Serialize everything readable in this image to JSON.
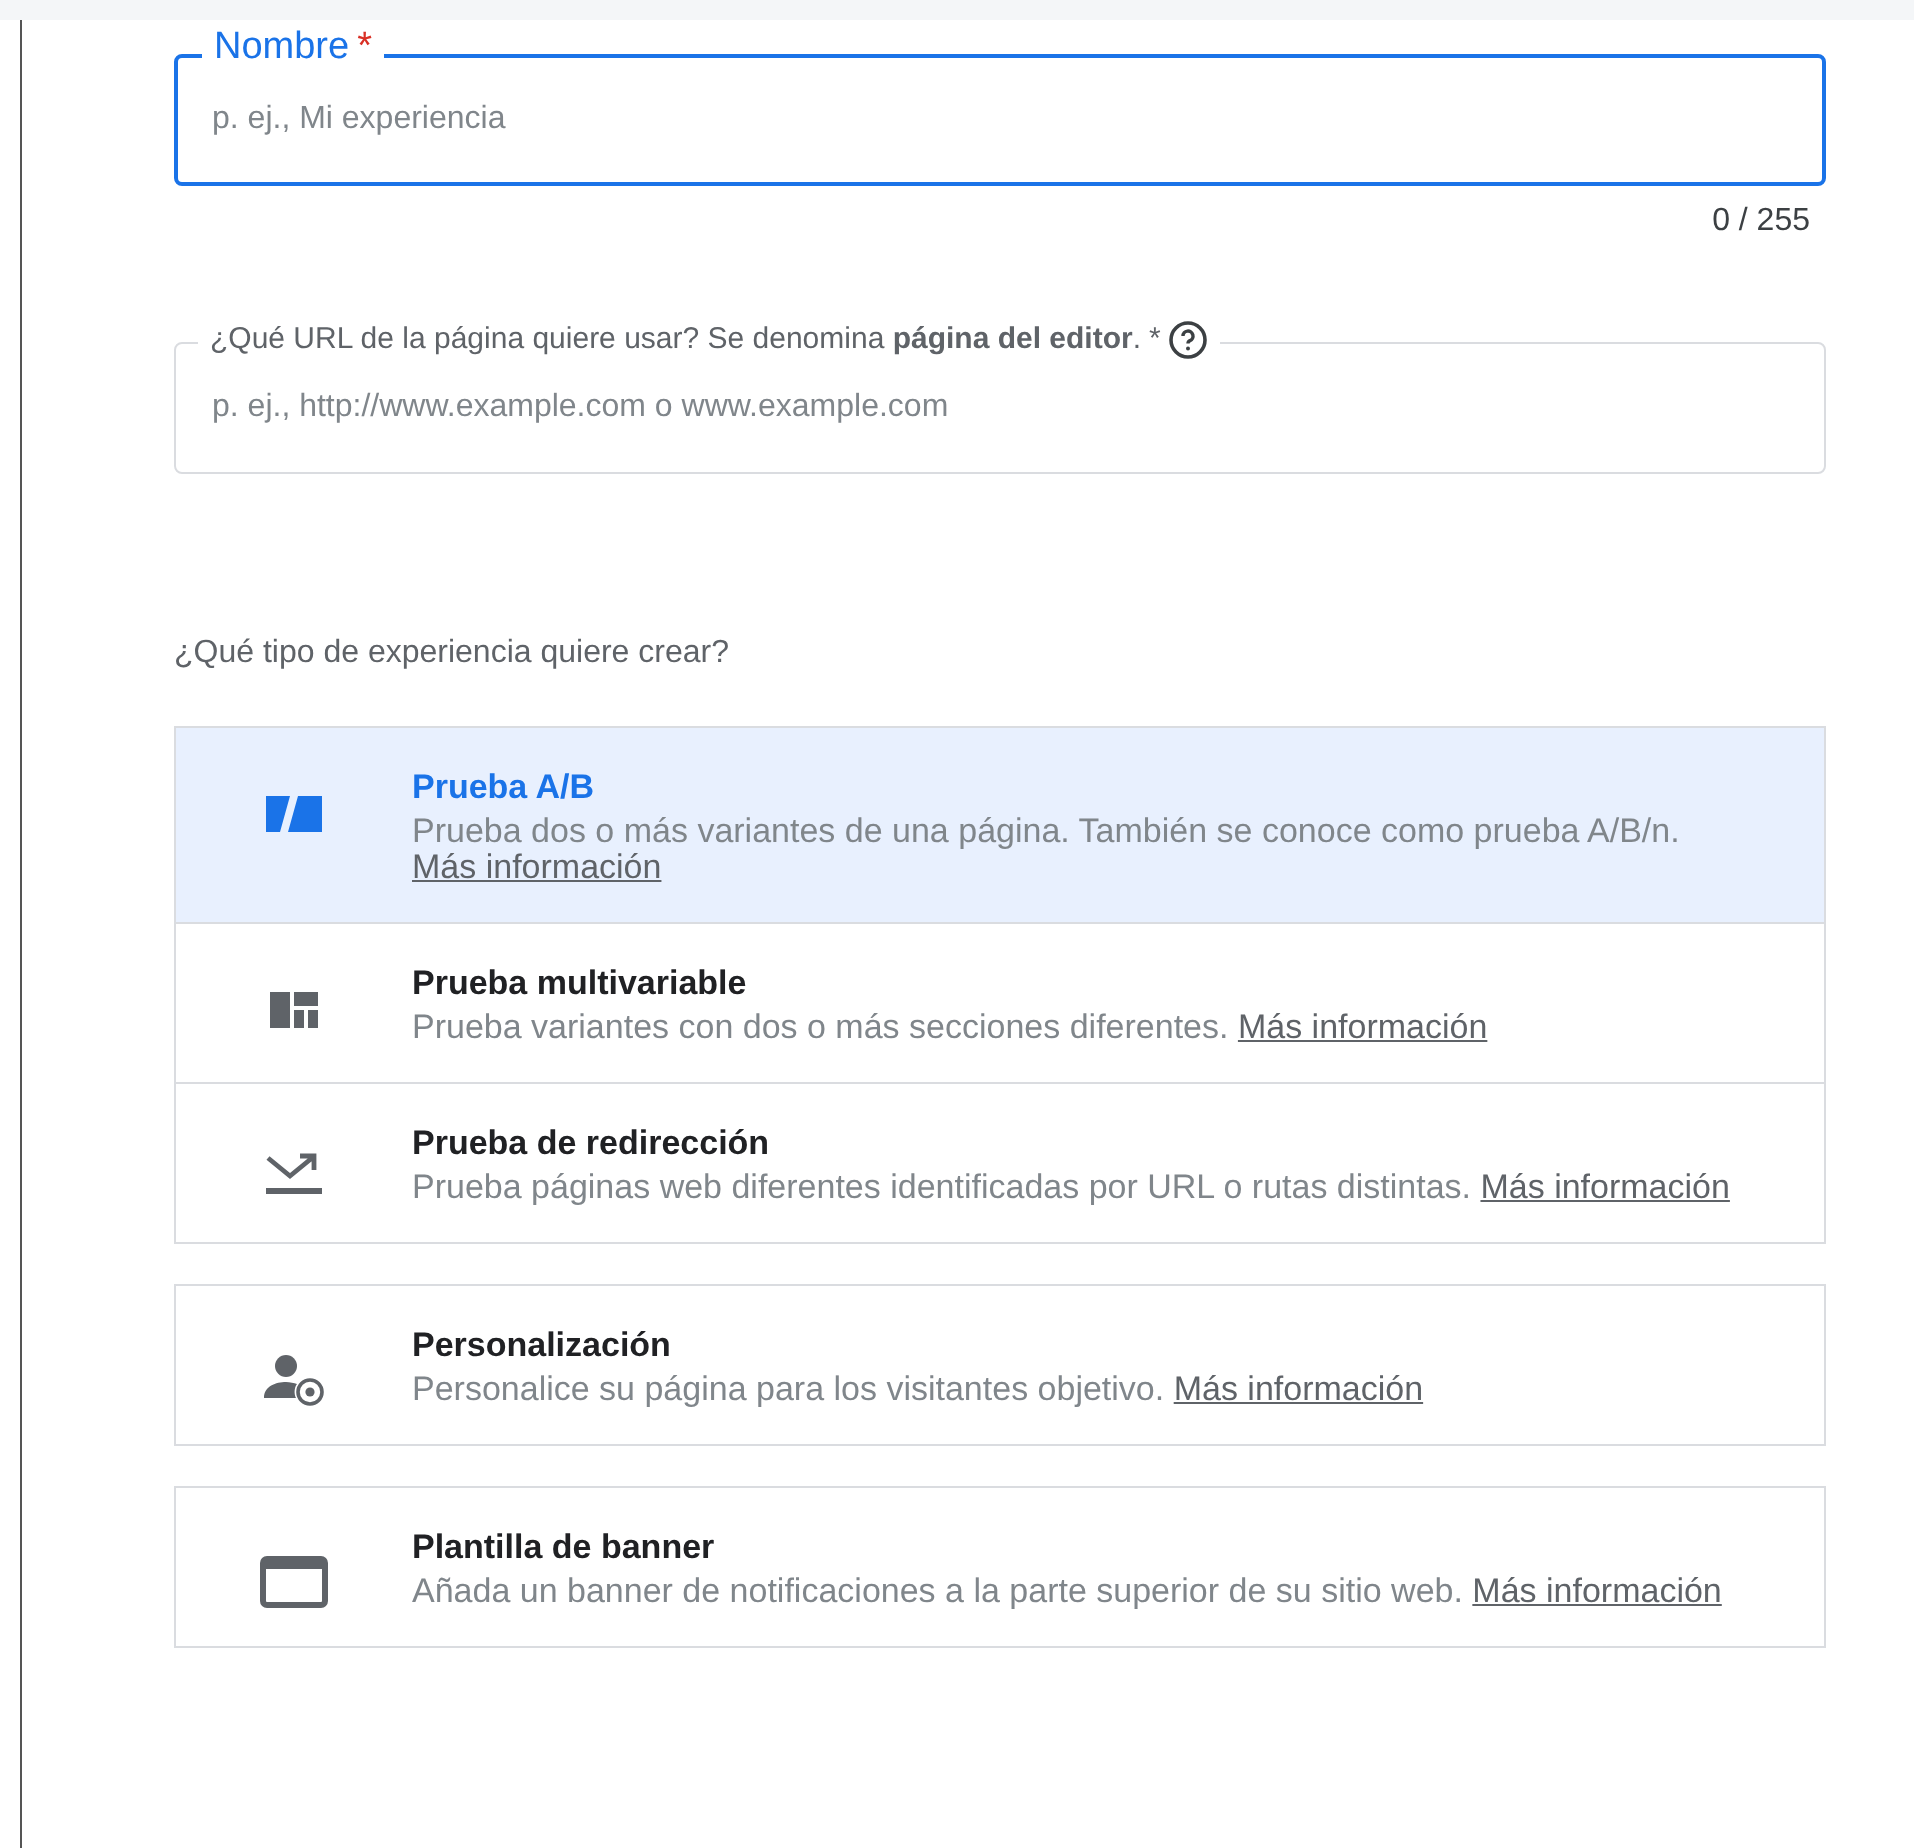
{
  "name_field": {
    "label": "Nombre",
    "required_mark": "*",
    "placeholder": "p. ej., Mi experiencia",
    "focused": true,
    "counter": "0 / 255"
  },
  "url_field": {
    "label": "¿Qué URL de la página quiere usar? Se denomina **página del editor**.",
    "required_mark": "*",
    "placeholder": "p. ej., http://www.example.com o www.example.com",
    "focused": false
  },
  "question": "¿Qué tipo de experiencia quiere crear?",
  "option_groups": [
    [
      {
        "title": "Prueba A/B",
        "description": "Prueba dos o más variantes de una página. También se conoce como prueba A/B/n.",
        "link": "Más información",
        "selected": true
      },
      {
        "title": "Prueba multivariable",
        "description": "Prueba variantes con dos o más secciones diferentes.",
        "link": "Más información",
        "selected": false
      },
      {
        "title": "Prueba de redirección",
        "description": "Prueba páginas web diferentes identificadas por URL o rutas distintas.",
        "link": "Más información",
        "selected": false
      }
    ],
    [
      {
        "title": "Personalización",
        "description": "Personalice su página para los visitantes objetivo.",
        "link": "Más información",
        "selected": false
      }
    ],
    [
      {
        "title": "Plantilla de banner",
        "description": "Añada un banner de notificaciones a la parte superior de su sitio web.",
        "link": "Más información",
        "selected": false
      }
    ]
  ]
}
